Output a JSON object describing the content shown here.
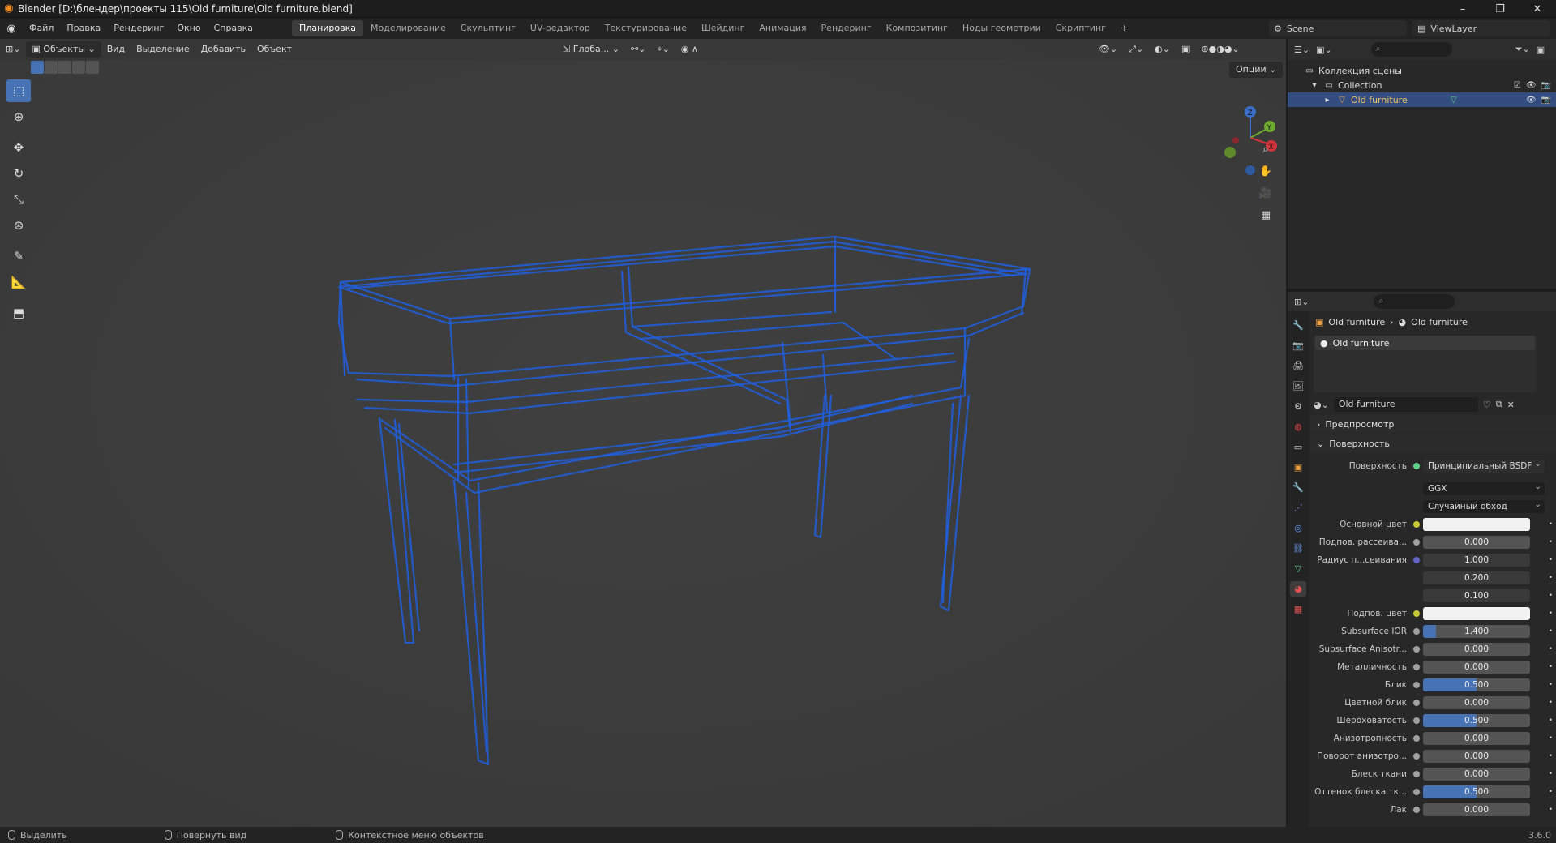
{
  "window": {
    "title": "Blender [D:\\блендер\\проекты 115\\Old furniture\\Old furniture.blend]",
    "controls": [
      "–",
      "❐",
      "✕"
    ]
  },
  "menu": [
    "Файл",
    "Правка",
    "Рендеринг",
    "Окно",
    "Справка"
  ],
  "workspaces": [
    {
      "label": "Планировка",
      "active": true
    },
    {
      "label": "Моделирование",
      "active": false
    },
    {
      "label": "Скульптинг",
      "active": false
    },
    {
      "label": "UV-редактор",
      "active": false
    },
    {
      "label": "Текстурирование",
      "active": false
    },
    {
      "label": "Шейдинг",
      "active": false
    },
    {
      "label": "Анимация",
      "active": false
    },
    {
      "label": "Рендеринг",
      "active": false
    },
    {
      "label": "Композитинг",
      "active": false
    },
    {
      "label": "Ноды геометрии",
      "active": false
    },
    {
      "label": "Скриптинг",
      "active": false
    }
  ],
  "scene": {
    "name": "Scene",
    "view_layer": "ViewLayer"
  },
  "viewport": {
    "mode": "Объекты",
    "menus": [
      "Вид",
      "Выделение",
      "Добавить",
      "Объект"
    ],
    "orientation": "Глоба...",
    "options_label": "Опции",
    "object_color": "#1f5fe0"
  },
  "outliner": {
    "search_placeholder": "",
    "scene_collection": "Коллекция сцены",
    "collection": "Collection",
    "object": "Old furniture"
  },
  "properties": {
    "breadcrumb_object": "Old furniture",
    "breadcrumb_material": "Old furniture",
    "slot_name": "Old furniture",
    "material_name": "Old furniture",
    "panel_preview": "Предпросмотр",
    "panel_surface": "Поверхность",
    "surface_label": "Поверхность",
    "surface_value": "Принципиальный BSDF",
    "distribution": "GGX",
    "subsurface_method": "Случайный обход",
    "rows": [
      {
        "label": "Основной цвет",
        "value": "",
        "type": "white",
        "socket": "#c8c832"
      },
      {
        "label": "Подпов. рассеива...",
        "value": "0.000",
        "type": "num",
        "fill": 0,
        "socket": "#a0a0a0"
      },
      {
        "label": "Радиус п...сеивания",
        "value": "1.000",
        "type": "dark",
        "socket": "#6363c7"
      },
      {
        "label": "",
        "value": "0.200",
        "type": "dark",
        "socket": ""
      },
      {
        "label": "",
        "value": "0.100",
        "type": "dark",
        "socket": ""
      },
      {
        "label": "Подпов. цвет",
        "value": "",
        "type": "white",
        "socket": "#c8c832"
      },
      {
        "label": "Subsurface IOR",
        "value": "1.400",
        "type": "num",
        "fill": 0.12,
        "socket": "#a0a0a0"
      },
      {
        "label": "Subsurface Anisotr...",
        "value": "0.000",
        "type": "num",
        "fill": 0,
        "socket": "#a0a0a0"
      },
      {
        "label": "Металличность",
        "value": "0.000",
        "type": "num",
        "fill": 0,
        "socket": "#a0a0a0"
      },
      {
        "label": "Блик",
        "value": "0.500",
        "type": "num",
        "fill": 0.5,
        "socket": "#a0a0a0"
      },
      {
        "label": "Цветной блик",
        "value": "0.000",
        "type": "num",
        "fill": 0,
        "socket": "#a0a0a0"
      },
      {
        "label": "Шероховатость",
        "value": "0.500",
        "type": "num",
        "fill": 0.5,
        "socket": "#a0a0a0"
      },
      {
        "label": "Анизотропность",
        "value": "0.000",
        "type": "num",
        "fill": 0,
        "socket": "#a0a0a0"
      },
      {
        "label": "Поворот анизотро...",
        "value": "0.000",
        "type": "num",
        "fill": 0,
        "socket": "#a0a0a0"
      },
      {
        "label": "Блеск ткани",
        "value": "0.000",
        "type": "num",
        "fill": 0,
        "socket": "#a0a0a0"
      },
      {
        "label": "Оттенок блеска тк...",
        "value": "0.500",
        "type": "num",
        "fill": 0.5,
        "socket": "#a0a0a0"
      },
      {
        "label": "Лак",
        "value": "0.000",
        "type": "num",
        "fill": 0,
        "socket": "#a0a0a0"
      }
    ]
  },
  "statusbar": {
    "select": "Выделить",
    "rotate": "Повернуть вид",
    "context": "Контекстное меню объектов",
    "version": "3.6.0"
  }
}
